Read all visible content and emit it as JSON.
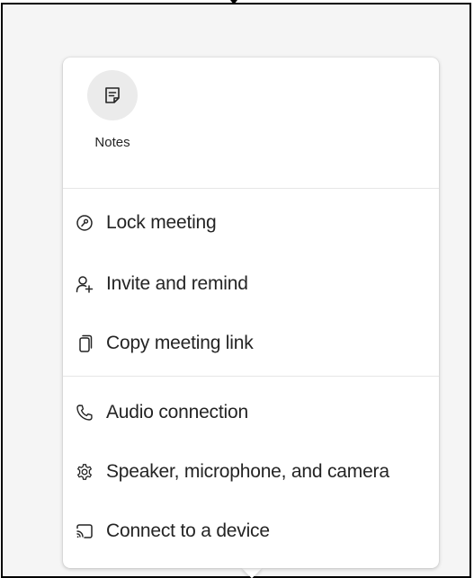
{
  "apps": [
    {
      "label": "Notes",
      "icon": "notes-icon"
    }
  ],
  "menu": {
    "group1": [
      {
        "label": "Lock meeting",
        "icon": "lock-meeting-icon"
      },
      {
        "label": "Invite and remind",
        "icon": "invite-person-icon"
      },
      {
        "label": "Copy meeting link",
        "icon": "copy-icon"
      }
    ],
    "group2": [
      {
        "label": "Audio connection",
        "icon": "phone-icon"
      },
      {
        "label": "Speaker, microphone, and camera",
        "icon": "settings-gear-icon"
      },
      {
        "label": "Connect to a device",
        "icon": "cast-icon"
      }
    ]
  },
  "colors": {
    "text": "#242424",
    "tile_background": "#ebebeb",
    "divider": "#e6e6e6"
  }
}
